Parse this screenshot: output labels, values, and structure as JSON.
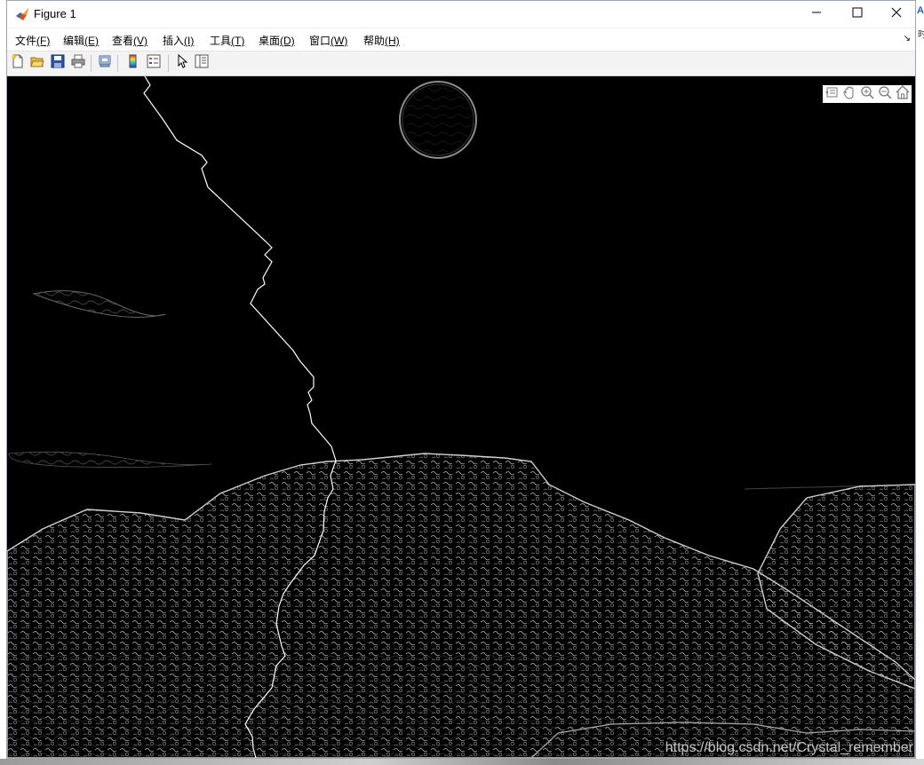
{
  "window": {
    "title": "Figure 1",
    "icon": "matlab-logo-icon",
    "controls": [
      "minimize-icon",
      "maximize-icon",
      "close-icon"
    ]
  },
  "menu": {
    "items": [
      {
        "label": "文件",
        "accel": "(F)"
      },
      {
        "label": "编辑",
        "accel": "(E)"
      },
      {
        "label": "查看",
        "accel": "(V)"
      },
      {
        "label": "插入",
        "accel": "(I)"
      },
      {
        "label": "工具",
        "accel": "(T)"
      },
      {
        "label": "桌面",
        "accel": "(D)"
      },
      {
        "label": "窗口",
        "accel": "(W)"
      },
      {
        "label": "帮助",
        "accel": "(H)"
      }
    ],
    "overflow_glyph": "↘"
  },
  "toolbar": {
    "buttons": [
      "new-figure-icon",
      "open-file-icon",
      "save-figure-icon",
      "print-figure-icon",
      "link-plot-icon",
      "insert-colorbar-icon",
      "insert-legend-icon",
      "edit-plot-arrow-icon",
      "property-inspector-icon"
    ]
  },
  "axes_toolbar": {
    "buttons": [
      "export-icon",
      "pan-hand-icon",
      "zoom-in-icon",
      "zoom-out-icon",
      "restore-view-home-icon"
    ]
  },
  "figure": {
    "content": "edge-detected grayscale image with seam line",
    "background": "#000000",
    "edge_color": "#ffffff"
  },
  "watermark": "https://blog.csdn.net/Crystal_remember",
  "background_peek": {
    "a": "A",
    "b": "时"
  },
  "colors": {
    "titlebar": "#ffffff",
    "menubar": "#ffffff",
    "toolbar": "#f3f3f3",
    "canvas": "#000000"
  }
}
